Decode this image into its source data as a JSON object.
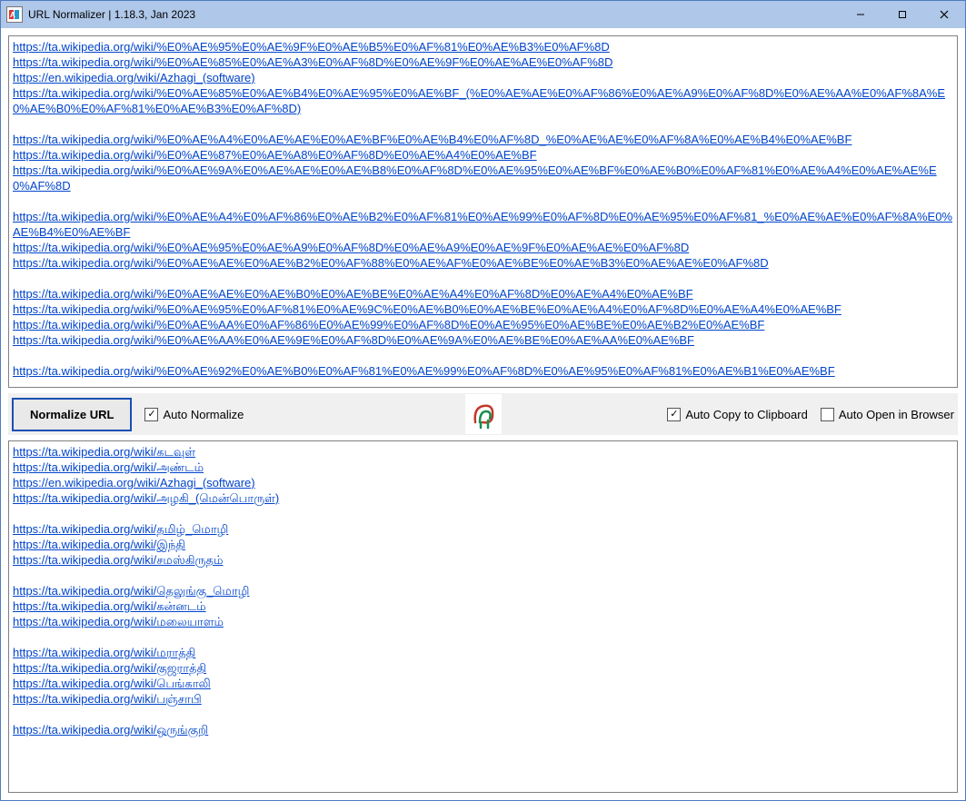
{
  "title": "URL Normalizer | 1.18.3, Jan 2023",
  "window_controls": {
    "minimize": "—",
    "maximize": "▢",
    "close": "✕"
  },
  "toolbar": {
    "normalize_label": "Normalize URL",
    "auto_normalize_label": "Auto Normalize",
    "auto_normalize_checked": true,
    "auto_copy_label": "Auto Copy to Clipboard",
    "auto_copy_checked": true,
    "auto_open_label": "Auto Open in Browser",
    "auto_open_checked": false
  },
  "input_urls": [
    "https://ta.wikipedia.org/wiki/%E0%AE%95%E0%AE%9F%E0%AE%B5%E0%AF%81%E0%AE%B3%E0%AF%8D",
    "https://ta.wikipedia.org/wiki/%E0%AE%85%E0%AE%A3%E0%AF%8D%E0%AE%9F%E0%AE%AE%E0%AF%8D",
    "https://en.wikipedia.org/wiki/Azhagi_(software)",
    "https://ta.wikipedia.org/wiki/%E0%AE%85%E0%AE%B4%E0%AE%95%E0%AE%BF_(%E0%AE%AE%E0%AF%86%E0%AE%A9%E0%AF%8D%E0%AE%AA%E0%AF%8A%E0%AE%B0%E0%AF%81%E0%AE%B3%E0%AF%8D)",
    "",
    "https://ta.wikipedia.org/wiki/%E0%AE%A4%E0%AE%AE%E0%AE%BF%E0%AE%B4%E0%AF%8D_%E0%AE%AE%E0%AF%8A%E0%AE%B4%E0%AE%BF",
    "https://ta.wikipedia.org/wiki/%E0%AE%87%E0%AE%A8%E0%AF%8D%E0%AE%A4%E0%AE%BF",
    "https://ta.wikipedia.org/wiki/%E0%AE%9A%E0%AE%AE%E0%AE%B8%E0%AF%8D%E0%AE%95%E0%AE%BF%E0%AE%B0%E0%AF%81%E0%AE%A4%E0%AE%AE%E0%AF%8D",
    "",
    "https://ta.wikipedia.org/wiki/%E0%AE%A4%E0%AF%86%E0%AE%B2%E0%AF%81%E0%AE%99%E0%AF%8D%E0%AE%95%E0%AF%81_%E0%AE%AE%E0%AF%8A%E0%AE%B4%E0%AE%BF",
    "https://ta.wikipedia.org/wiki/%E0%AE%95%E0%AE%A9%E0%AF%8D%E0%AE%A9%E0%AE%9F%E0%AE%AE%E0%AF%8D",
    "https://ta.wikipedia.org/wiki/%E0%AE%AE%E0%AE%B2%E0%AF%88%E0%AE%AF%E0%AE%BE%E0%AE%B3%E0%AE%AE%E0%AF%8D",
    "",
    "https://ta.wikipedia.org/wiki/%E0%AE%AE%E0%AE%B0%E0%AE%BE%E0%AE%A4%E0%AF%8D%E0%AE%A4%E0%AE%BF",
    "https://ta.wikipedia.org/wiki/%E0%AE%95%E0%AF%81%E0%AE%9C%E0%AE%B0%E0%AE%BE%E0%AE%A4%E0%AF%8D%E0%AE%A4%E0%AE%BF",
    "https://ta.wikipedia.org/wiki/%E0%AE%AA%E0%AF%86%E0%AE%99%E0%AF%8D%E0%AE%95%E0%AE%BE%E0%AE%B2%E0%AE%BF",
    "https://ta.wikipedia.org/wiki/%E0%AE%AA%E0%AE%9E%E0%AF%8D%E0%AE%9A%E0%AE%BE%E0%AE%AA%E0%AE%BF",
    "",
    "https://ta.wikipedia.org/wiki/%E0%AE%92%E0%AE%B0%E0%AF%81%E0%AE%99%E0%AF%8D%E0%AE%95%E0%AF%81%E0%AE%B1%E0%AE%BF"
  ],
  "output_urls": [
    "https://ta.wikipedia.org/wiki/கடவுள்",
    "https://ta.wikipedia.org/wiki/அண்டம்",
    "https://en.wikipedia.org/wiki/Azhagi_(software)",
    "https://ta.wikipedia.org/wiki/அழகி_(மென்பொருள்)",
    "",
    "https://ta.wikipedia.org/wiki/தமிழ்_மொழி",
    "https://ta.wikipedia.org/wiki/இந்தி",
    "https://ta.wikipedia.org/wiki/சமஸ்கிருதம்",
    "",
    "https://ta.wikipedia.org/wiki/தெலுங்கு_மொழி",
    "https://ta.wikipedia.org/wiki/கன்னடம்",
    "https://ta.wikipedia.org/wiki/மலையாளம்",
    "",
    "https://ta.wikipedia.org/wiki/மராத்தி",
    "https://ta.wikipedia.org/wiki/குஜராத்தி",
    "https://ta.wikipedia.org/wiki/பெங்காலி",
    "https://ta.wikipedia.org/wiki/பஞ்சாபி",
    "",
    "https://ta.wikipedia.org/wiki/ஒருங்குறி"
  ]
}
